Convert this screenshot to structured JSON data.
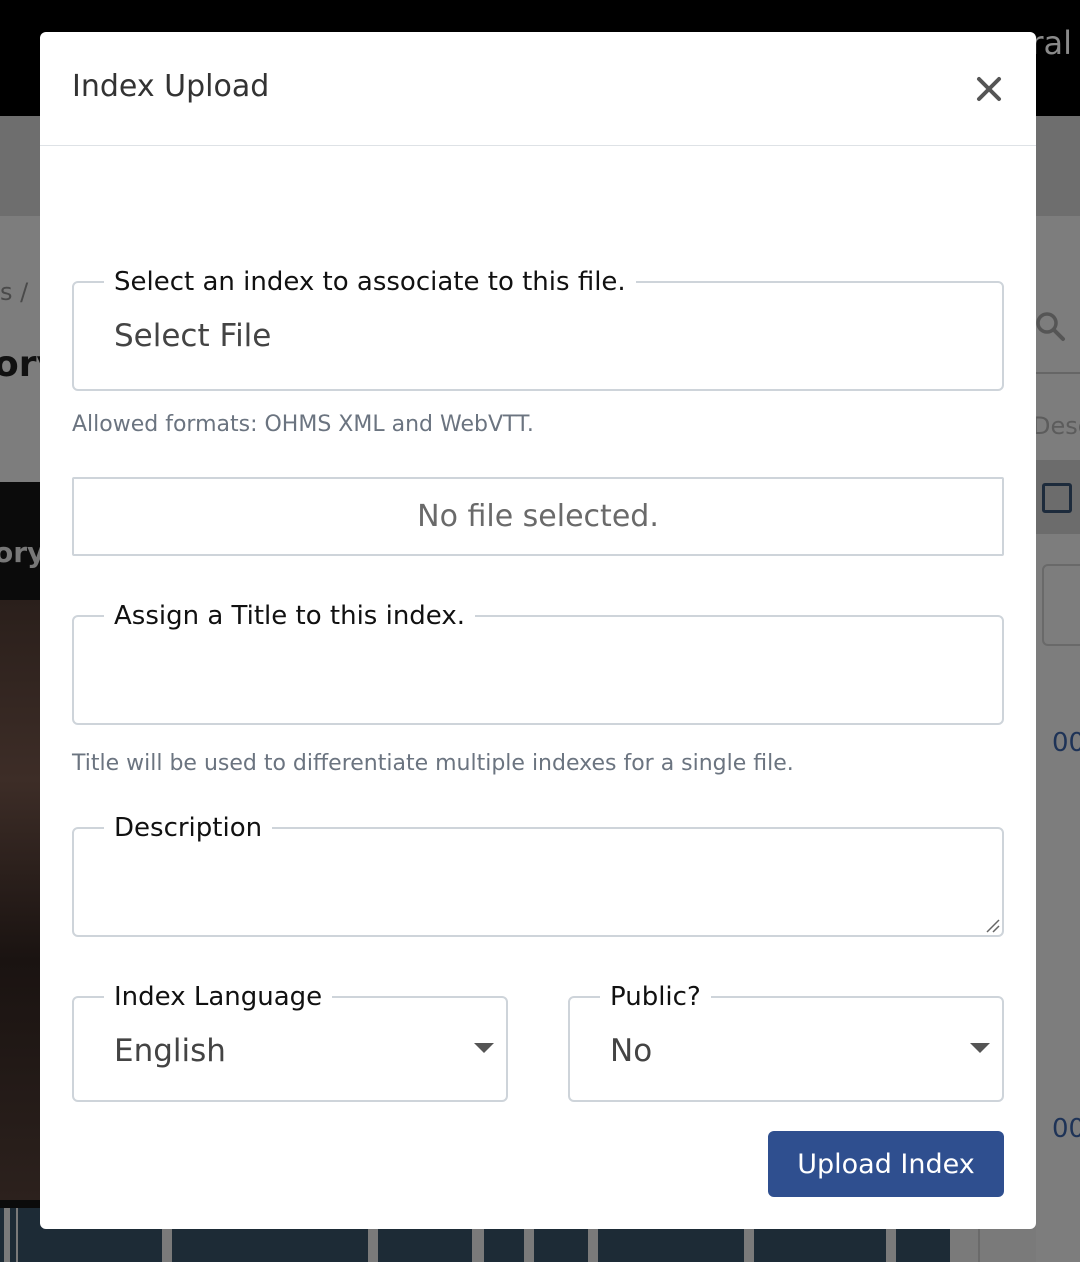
{
  "background": {
    "topbar_text": "ral",
    "breadcrumb": "s /",
    "heading": "ory",
    "video_caption": "ory",
    "desc_fragment": "Desc",
    "time_1": "00",
    "time_2": "00"
  },
  "modal": {
    "title": "Index Upload",
    "close_icon": "close-icon",
    "select_file": {
      "legend": "Select an index to associate to this file.",
      "value": "Select File",
      "help": "Allowed formats: OHMS XML and WebVTT."
    },
    "file_status": "No file selected.",
    "title_field": {
      "legend": "Assign a Title to this index.",
      "value": "",
      "help": "Title will be used to differentiate multiple indexes for a single file."
    },
    "description": {
      "legend": "Description",
      "value": ""
    },
    "language": {
      "legend": "Index Language",
      "selected": "English"
    },
    "public": {
      "legend": "Public?",
      "selected": "No"
    },
    "submit_label": "Upload Index"
  },
  "colors": {
    "primary_button": "#2f4f8f",
    "overlay": "#7a7a7a"
  }
}
